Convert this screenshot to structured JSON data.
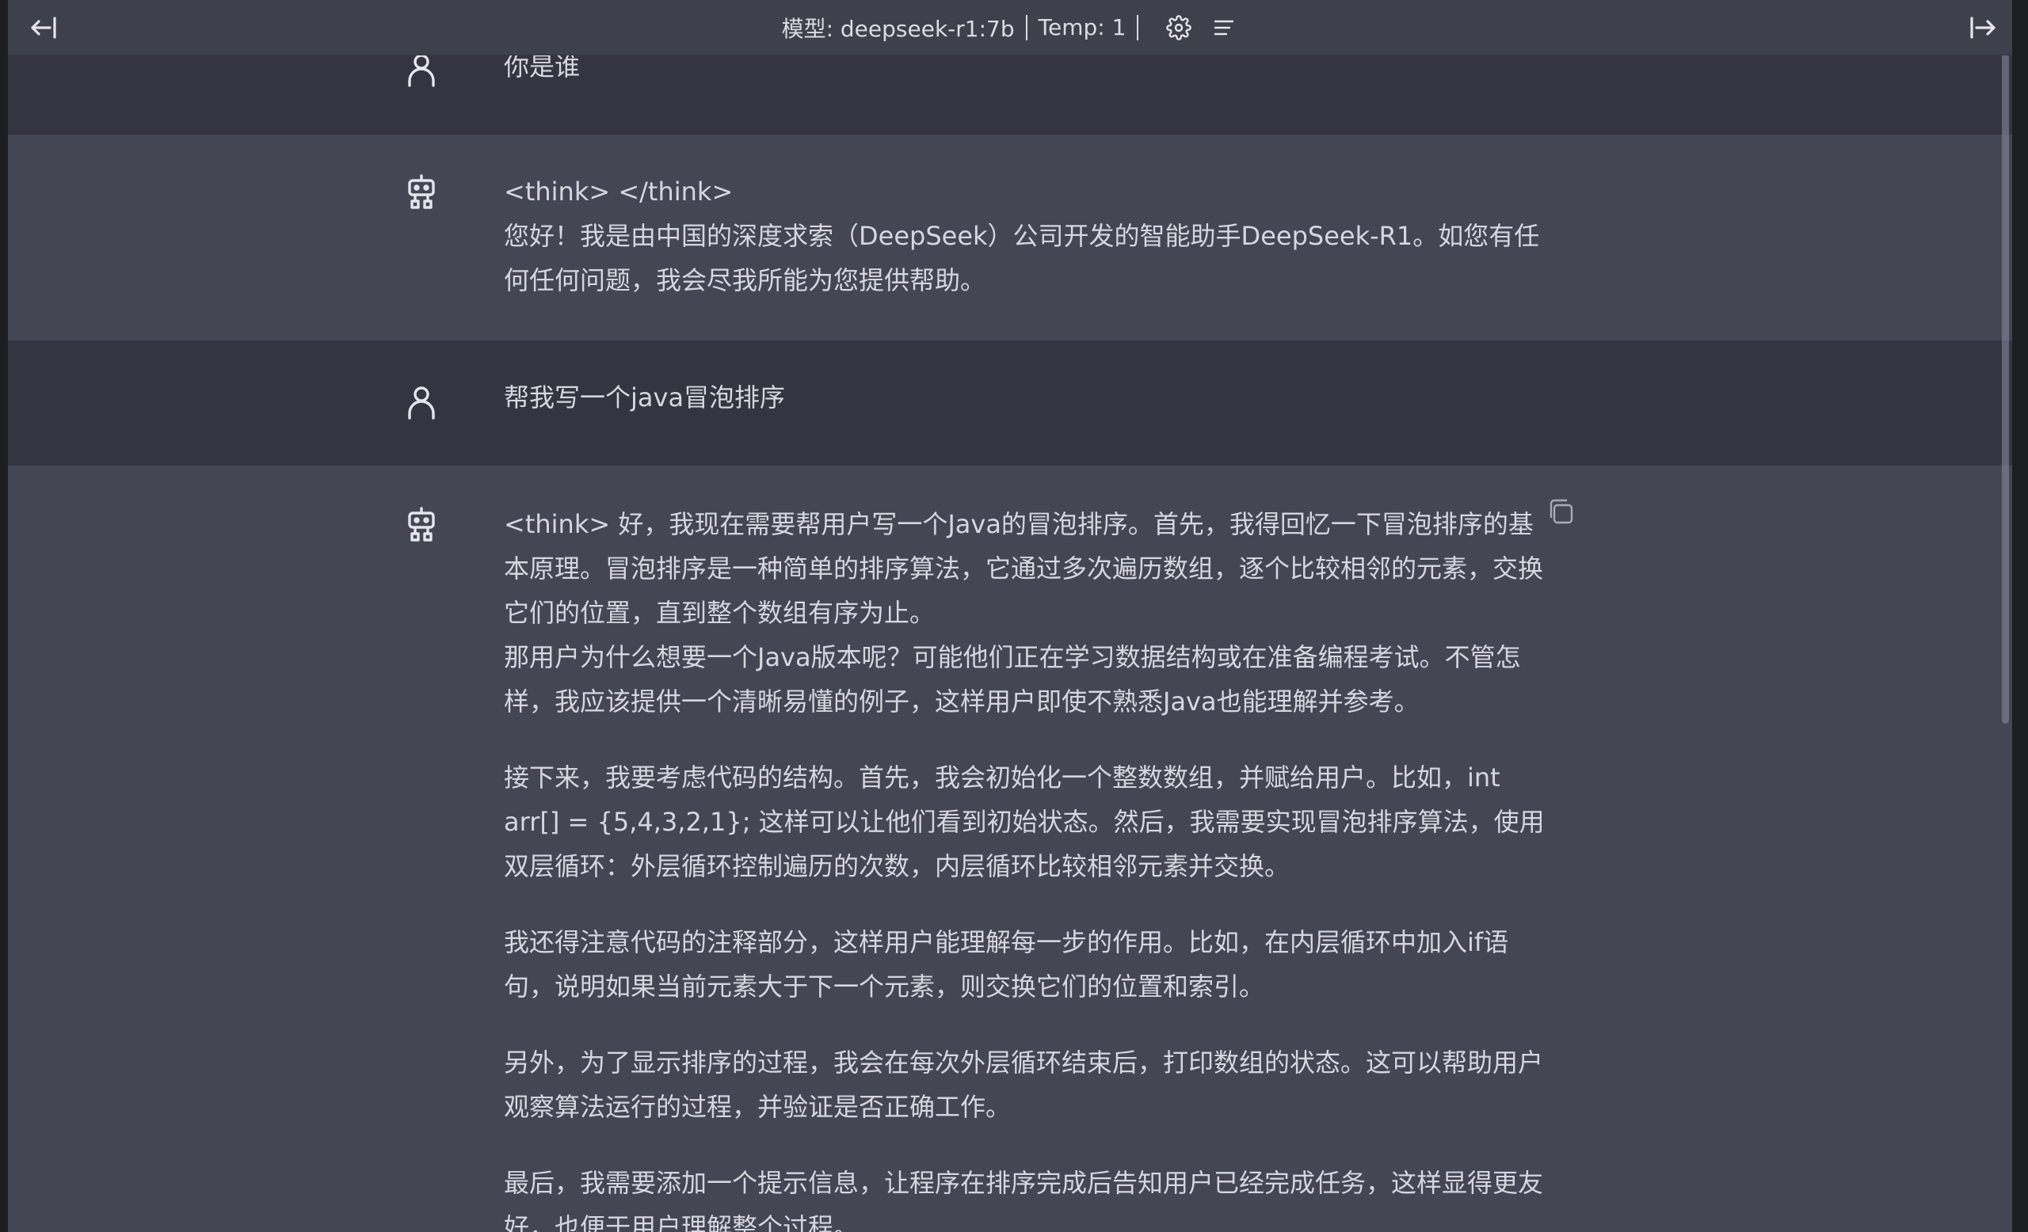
{
  "topbar": {
    "model_label": "模型: deepseek-r1:7b",
    "temp_label": "Temp: 1"
  },
  "messages": [
    {
      "role": "user",
      "lines": [
        "你是谁"
      ]
    },
    {
      "role": "assistant",
      "lines": [
        "<think> </think>",
        "您好！我是由中国的深度求索（DeepSeek）公司开发的智能助手DeepSeek-R1。如您有任何任何问题，我会尽我所能为您提供帮助。"
      ]
    },
    {
      "role": "user",
      "lines": [
        "帮我写一个java冒泡排序"
      ]
    },
    {
      "role": "assistant",
      "paragraphs": [
        "<think> 好，我现在需要帮用户写一个Java的冒泡排序。首先，我得回忆一下冒泡排序的基本原理。冒泡排序是一种简单的排序算法，它通过多次遍历数组，逐个比较相邻的元素，交换它们的位置，直到整个数组有序为止。",
        "那用户为什么想要一个Java版本呢？可能他们正在学习数据结构或在准备编程考试。不管怎样，我应该提供一个清晰易懂的例子，这样用户即使不熟悉Java也能理解并参考。",
        "接下来，我要考虑代码的结构。首先，我会初始化一个整数数组，并赋给用户。比如，int arr[] = {5,4,3,2,1}; 这样可以让他们看到初始状态。然后，我需要实现冒泡排序算法，使用双层循环：外层循环控制遍历的次数，内层循环比较相邻元素并交换。",
        "我还得注意代码的注释部分，这样用户能理解每一步的作用。比如，在内层循环中加入if语句，说明如果当前元素大于下一个元素，则交换它们的位置和索引。",
        "另外，为了显示排序的过程，我会在每次外层循环结束后，打印数组的状态。这可以帮助用户观察算法运行的过程，并验证是否正确工作。",
        "最后，我需要添加一个提示信息，让程序在排序完成后告知用户已经完成任务，这样显得更友好，也便于用户理解整个过程。"
      ]
    }
  ]
}
